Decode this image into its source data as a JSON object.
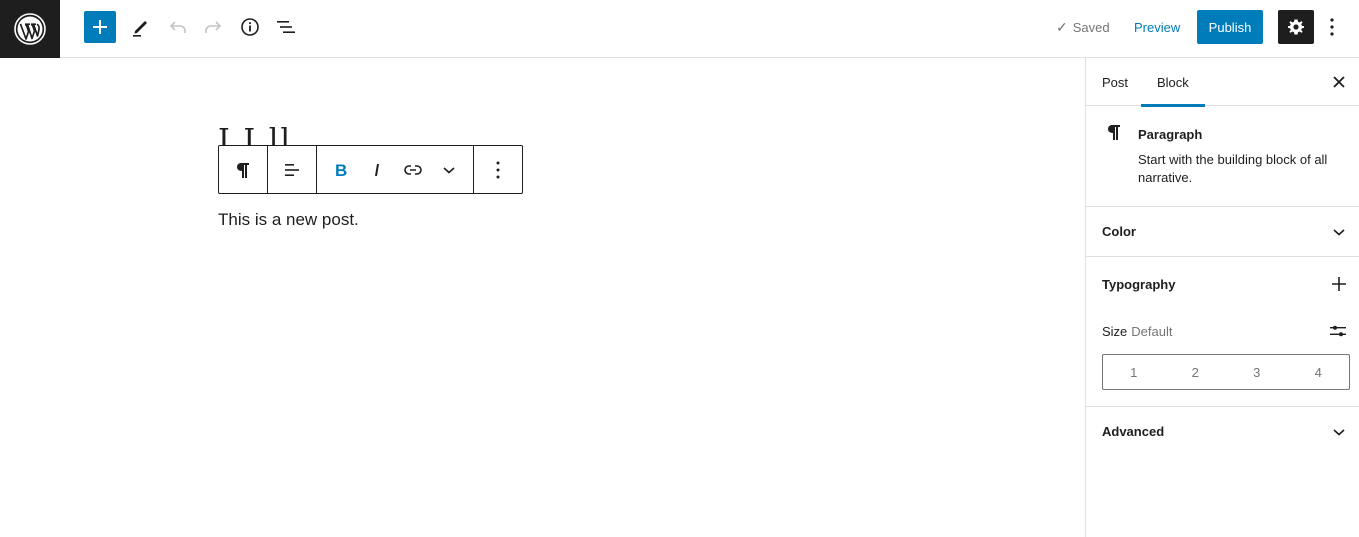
{
  "header": {
    "logo": "wordpress-logo",
    "inserter_label": "Add block",
    "tools_label": "Tools",
    "undo_label": "Undo",
    "redo_label": "Redo",
    "details_label": "Details",
    "list_view_label": "List View",
    "saved_label": "Saved",
    "preview_label": "Preview",
    "publish_label": "Publish",
    "settings_label": "Settings",
    "options_label": "Options",
    "accent_color": "#007cba"
  },
  "editor": {
    "title_peek": "I I  ll",
    "paragraph_text": "This is a new post.",
    "block_toolbar": {
      "block_type": "Paragraph",
      "align": "Align text",
      "bold": "Bold",
      "italic": "Italic",
      "link": "Link",
      "more_rich": "More",
      "options": "Options"
    }
  },
  "sidebar": {
    "tabs": [
      {
        "label": "Post",
        "active": false
      },
      {
        "label": "Block",
        "active": true
      }
    ],
    "close_label": "Close settings",
    "block_card": {
      "title": "Paragraph",
      "description": "Start with the building block of all narrative."
    },
    "panels": {
      "color": {
        "label": "Color"
      },
      "typography": {
        "label": "Typography",
        "size_label": "Size",
        "size_value": "Default",
        "size_options": [
          "1",
          "2",
          "3",
          "4"
        ]
      },
      "advanced": {
        "label": "Advanced"
      }
    }
  }
}
